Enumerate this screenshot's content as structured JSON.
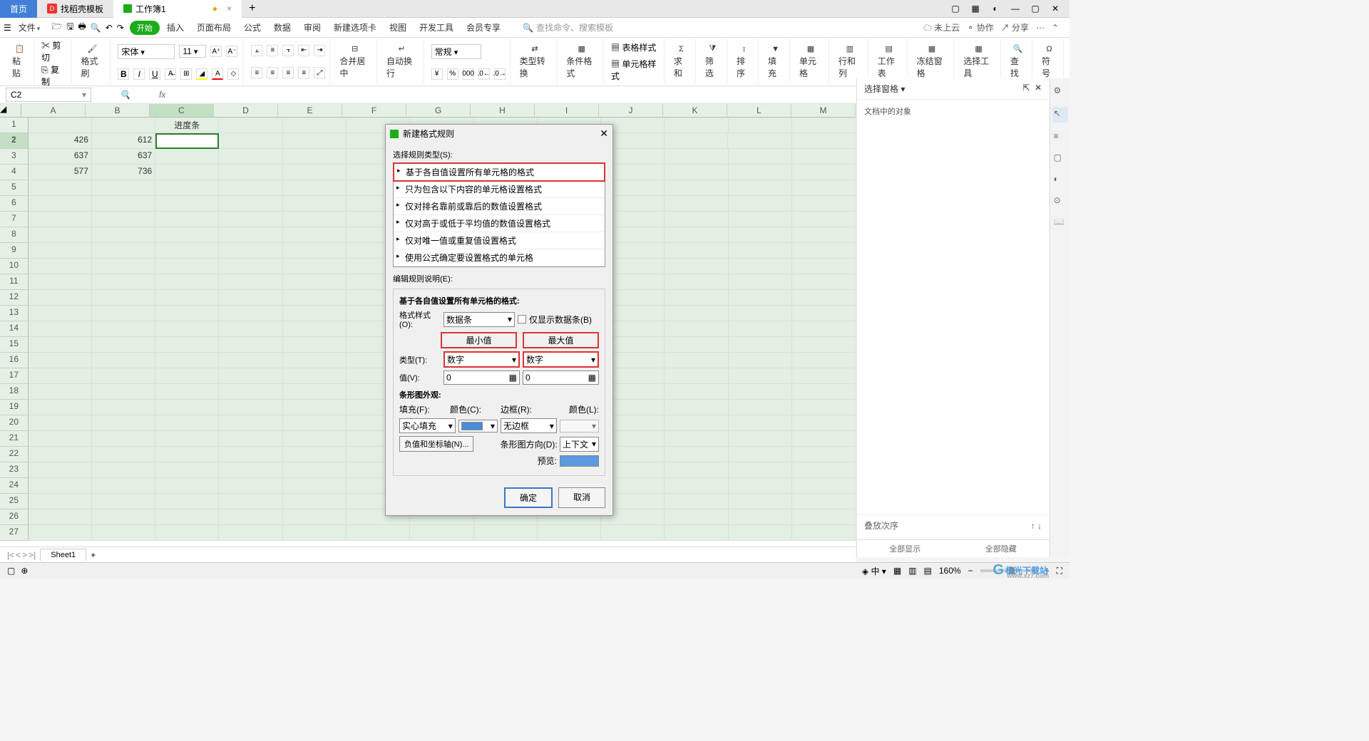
{
  "tabs": {
    "home": "首页",
    "template": "找稻壳模板",
    "workbook": "工作簿1",
    "add": "+"
  },
  "menubar": {
    "file": "文件",
    "start": "开始",
    "insert": "插入",
    "page_layout": "页面布局",
    "formula": "公式",
    "data": "数据",
    "review": "审阅",
    "newtab": "新建选项卡",
    "view": "视图",
    "devtools": "开发工具",
    "member": "会员专享",
    "search_placeholder": "查找命令、搜索模板",
    "not_cloud": "未上云",
    "collab": "协作",
    "share": "分享"
  },
  "ribbon": {
    "paste": "粘贴",
    "cut": "剪切",
    "copy": "复制",
    "format_painter": "格式刷",
    "font_name": "宋体",
    "font_size": "11",
    "merge": "合并居中",
    "wrap": "自动换行",
    "general": "常规",
    "type_convert": "类型转换",
    "cond_format": "条件格式",
    "cell_style": "单元格样式",
    "table_style": "表格样式",
    "sum": "求和",
    "filter": "筛选",
    "sort": "排序",
    "fill": "填充",
    "cells": "单元格",
    "rowcol": "行和列",
    "worksheet": "工作表",
    "freeze": "冻结窗格",
    "select_tool": "选择工具",
    "find": "查找",
    "symbol": "符号"
  },
  "refbar": {
    "cell": "C2",
    "fx": "fx"
  },
  "grid": {
    "cols": [
      "A",
      "B",
      "C",
      "D",
      "E",
      "F",
      "G",
      "H",
      "I",
      "J",
      "K",
      "L",
      "M"
    ],
    "rows_count": 27,
    "data": {
      "C1": "进度条",
      "A2": "426",
      "B2": "612",
      "A3": "637",
      "B3": "637",
      "A4": "577",
      "B4": "736"
    },
    "selected": "C2"
  },
  "dialog": {
    "title": "新建格式规则",
    "select_rule_type": "选择规则类型(S):",
    "rules": [
      "基于各自值设置所有单元格的格式",
      "只为包含以下内容的单元格设置格式",
      "仅对排名靠前或靠后的数值设置格式",
      "仅对高于或低于平均值的数值设置格式",
      "仅对唯一值或重复值设置格式",
      "使用公式确定要设置格式的单元格"
    ],
    "edit_desc": "编辑规则说明(E):",
    "based_on": "基于各自值设置所有单元格的格式:",
    "format_style": "格式样式(O):",
    "format_style_val": "数据条",
    "show_bar_only": "仅显示数据条(B)",
    "min_label": "最小值",
    "max_label": "最大值",
    "type_label": "类型(T):",
    "type_min": "数字",
    "type_max": "数字",
    "value_label": "值(V):",
    "value_min": "0",
    "value_max": "0",
    "bar_appearance": "条形图外观:",
    "fill_label": "填充(F):",
    "fill_val": "实心填充",
    "color_label": "颜色(C):",
    "border_label": "边框(R):",
    "border_val": "无边框",
    "color2_label": "颜色(L):",
    "neg_axis": "负值和坐标轴(N)...",
    "bar_direction": "条形图方向(D):",
    "direction_val": "上下文",
    "preview_label": "预览:",
    "ok": "确定",
    "cancel": "取消"
  },
  "side": {
    "title": "选择窗格",
    "obj_doc": "文档中的对象",
    "stack_order": "叠放次序",
    "show_all": "全部显示",
    "hide_all": "全部隐藏"
  },
  "sheet_tabs": {
    "sheet1": "Sheet1"
  },
  "statusbar": {
    "zoom": "160%",
    "ime": "中"
  },
  "watermark": "极光下载站"
}
